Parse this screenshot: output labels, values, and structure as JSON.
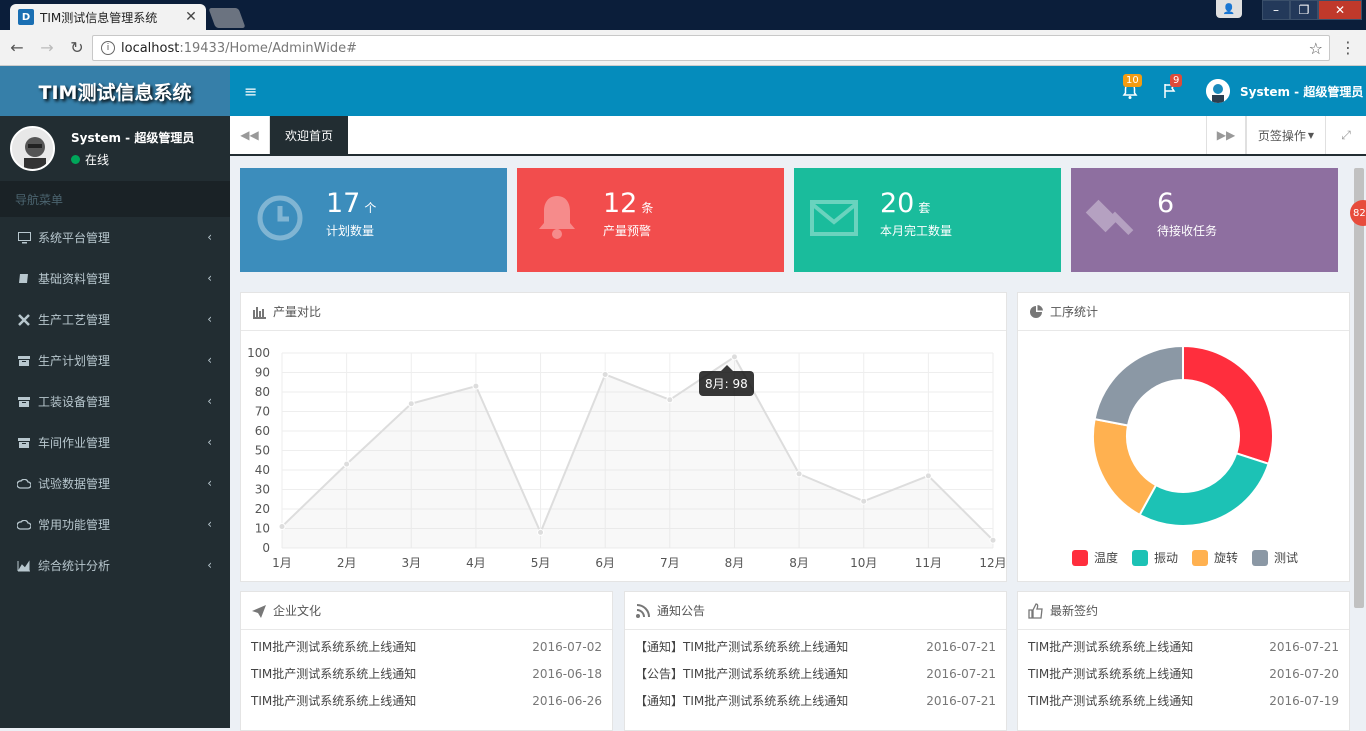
{
  "browser": {
    "tab_title": "TIM测试信息管理系统",
    "url_host": "localhost",
    "url_path": ":19433/Home/AdminWide#"
  },
  "app": {
    "logo": "TIM测试信息系统",
    "user_name": "System - 超级管理员",
    "user_status": "在线",
    "nav_header": "导航菜单",
    "nav_items": [
      {
        "label": "系统平台管理",
        "icon": "monitor-icon"
      },
      {
        "label": "基础资料管理",
        "icon": "book-icon"
      },
      {
        "label": "生产工艺管理",
        "icon": "tools-icon"
      },
      {
        "label": "生产计划管理",
        "icon": "archive-icon"
      },
      {
        "label": "工装设备管理",
        "icon": "archive-icon"
      },
      {
        "label": "车间作业管理",
        "icon": "archive-icon"
      },
      {
        "label": "试验数据管理",
        "icon": "cloud-icon"
      },
      {
        "label": "常用功能管理",
        "icon": "cloud-icon"
      },
      {
        "label": "综合统计分析",
        "icon": "area-chart-icon"
      }
    ]
  },
  "header": {
    "bell_badge": "10",
    "flag_badge": "9",
    "user_name": "System - 超级管理员"
  },
  "tabs": {
    "home": "欢迎首页",
    "operations": "页签操作"
  },
  "cards": [
    {
      "num": "17",
      "unit": "个",
      "label": "计划数量",
      "color": "#3c8dbc",
      "icon": "clock-icon"
    },
    {
      "num": "12",
      "unit": "条",
      "label": "产量预警",
      "color": "#f24d4d",
      "icon": "bell-icon"
    },
    {
      "num": "20",
      "unit": "套",
      "label": "本月完工数量",
      "color": "#1abc9c",
      "icon": "envelope-icon"
    },
    {
      "num": "6",
      "unit": "",
      "label": "待接收任务",
      "color": "#8e6fa0",
      "icon": "gavel-icon"
    }
  ],
  "side_badge": "82",
  "line_panel": {
    "title": "产量对比",
    "tooltip": "8月: 98"
  },
  "pie_panel": {
    "title": "工序统计"
  },
  "chart_data": [
    {
      "type": "line",
      "categories": [
        "1月",
        "2月",
        "3月",
        "4月",
        "5月",
        "6月",
        "7月",
        "8月",
        "8月",
        "10月",
        "11月",
        "12月"
      ],
      "values": [
        11,
        43,
        74,
        83,
        8,
        89,
        76,
        98,
        38,
        24,
        37,
        4
      ],
      "ylim": [
        0,
        100
      ],
      "yticks": [
        0,
        10,
        20,
        30,
        40,
        50,
        60,
        70,
        80,
        90,
        100
      ],
      "grid": true,
      "line_color": "#dddddd"
    },
    {
      "type": "pie",
      "donut": true,
      "labels": [
        "温度",
        "振动",
        "旋转",
        "测试"
      ],
      "values": [
        30,
        28,
        20,
        22
      ],
      "colors": [
        "#ff2e3d",
        "#1cc2b5",
        "#ffb150",
        "#8b98a5"
      ]
    }
  ],
  "lists": [
    {
      "title": "企业文化",
      "icon": "paper-plane-icon",
      "rows": [
        {
          "text": "TIM批产测试系统系统上线通知",
          "date": "2016-07-02"
        },
        {
          "text": "TIM批产测试系统系统上线通知",
          "date": "2016-06-18"
        },
        {
          "text": "TIM批产测试系统系统上线通知",
          "date": "2016-06-26"
        }
      ]
    },
    {
      "title": "通知公告",
      "icon": "rss-icon",
      "rows": [
        {
          "text": "【通知】TIM批产测试系统系统上线通知",
          "date": "2016-07-21"
        },
        {
          "text": "【公告】TIM批产测试系统系统上线通知",
          "date": "2016-07-21"
        },
        {
          "text": "【通知】TIM批产测试系统系统上线通知",
          "date": "2016-07-21"
        }
      ]
    },
    {
      "title": "最新签约",
      "icon": "thumbs-up-icon",
      "rows": [
        {
          "text": "TIM批产测试系统系统上线通知",
          "date": "2016-07-21"
        },
        {
          "text": "TIM批产测试系统系统上线通知",
          "date": "2016-07-20"
        },
        {
          "text": "TIM批产测试系统系统上线通知",
          "date": "2016-07-19"
        }
      ]
    }
  ]
}
